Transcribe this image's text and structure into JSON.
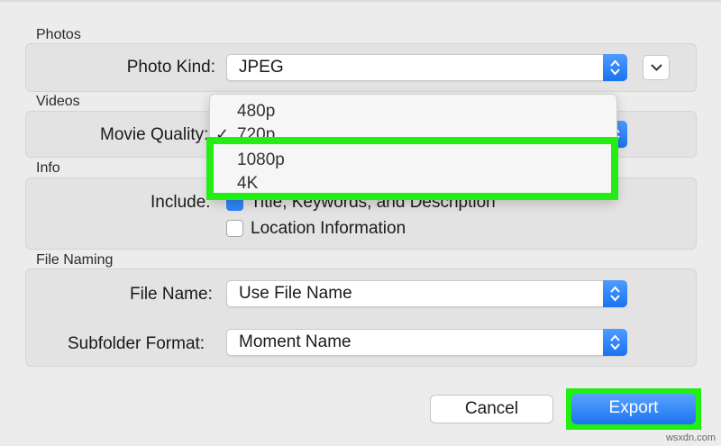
{
  "sections": {
    "photos": "Photos",
    "videos": "Videos",
    "info": "Info",
    "file_naming": "File Naming"
  },
  "photos": {
    "photo_kind_label": "Photo Kind:",
    "photo_kind_value": "JPEG"
  },
  "videos": {
    "movie_quality_label": "Movie Quality:"
  },
  "info": {
    "include_label": "Include:",
    "title_option": "Title, Keywords, and Description",
    "title_checked": true,
    "location_option": "Location Information",
    "location_checked": false
  },
  "movie_quality_menu": {
    "items": [
      "480p",
      "720p",
      "1080p",
      "4K"
    ],
    "selected": "720p",
    "checkmark": "✓"
  },
  "file_naming": {
    "file_name_label": "File Name:",
    "file_name_value": "Use File Name",
    "subfolder_label": "Subfolder Format:",
    "subfolder_value": "Moment Name"
  },
  "buttons": {
    "cancel": "Cancel",
    "export": "Export"
  },
  "colors": {
    "accent": "#1a73f0",
    "highlight": "#22ee14"
  },
  "watermark": "wsxdn.com"
}
